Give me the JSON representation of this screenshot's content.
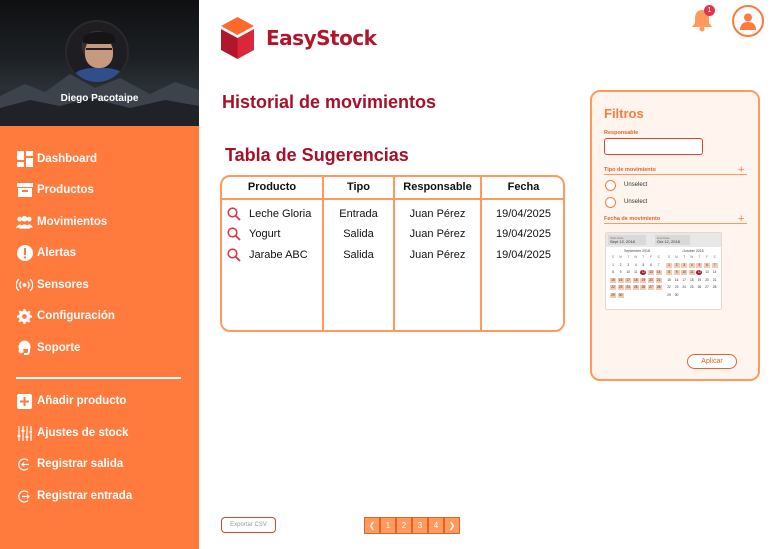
{
  "app": {
    "name": "EasyStock"
  },
  "colors": {
    "accent": "#ff7a3d",
    "title": "#a8102a",
    "border": "#ff9a5c"
  },
  "profile": {
    "name": "Diego Pacotaipe"
  },
  "sidebar": {
    "items": [
      {
        "label": "Dashboard",
        "icon": "dashboard-icon"
      },
      {
        "label": "Productos",
        "icon": "box-icon"
      },
      {
        "label": "Movimientos",
        "icon": "users-icon"
      },
      {
        "label": "Alertas",
        "icon": "alert-icon"
      },
      {
        "label": "Sensores",
        "icon": "sensor-icon"
      },
      {
        "label": "Configuración",
        "icon": "gear-icon"
      },
      {
        "label": "Soporte",
        "icon": "support-icon"
      }
    ],
    "actions": [
      {
        "label": "Añadir producto",
        "icon": "add-icon"
      },
      {
        "label": "Ajustes de stock",
        "icon": "sliders-icon"
      },
      {
        "label": "Registrar salida",
        "icon": "exit-icon"
      },
      {
        "label": "Registrar entrada",
        "icon": "entry-icon"
      }
    ]
  },
  "header": {
    "notification_count": "1"
  },
  "page": {
    "title": "Historial de movimientos",
    "table_title": "Tabla de Sugerencias"
  },
  "table": {
    "columns": [
      "Producto",
      "Tipo",
      "Responsable",
      "Fecha"
    ],
    "rows": [
      {
        "producto": "Leche Gloria",
        "tipo": "Entrada",
        "responsable": "Juan Pérez",
        "fecha": "19/04/2025"
      },
      {
        "producto": "Yogurt",
        "tipo": "Salida",
        "responsable": "Juan Pérez",
        "fecha": "19/04/2025"
      },
      {
        "producto": "Jarabe ABC",
        "tipo": "Salida",
        "responsable": "Juan Pérez",
        "fecha": "19/04/2025"
      }
    ]
  },
  "filters": {
    "title": "Filtros",
    "responsable_label": "Responsable",
    "responsable_value": "",
    "tipo_label": "Tipo de movimiento",
    "options": [
      "Unselect",
      "Unselect"
    ],
    "fecha_label": "Fecha de movimiento",
    "start_label": "Start Date",
    "start_value": "Sept 12, 2018",
    "end_label": "End Date",
    "end_value": "Oct 12, 2018",
    "month_left": "September 2018",
    "month_right": "October 2018",
    "apply_label": "Aplicar"
  },
  "footer": {
    "export_label": "Exportar CSV",
    "pages": [
      "1",
      "2",
      "3",
      "4"
    ]
  }
}
